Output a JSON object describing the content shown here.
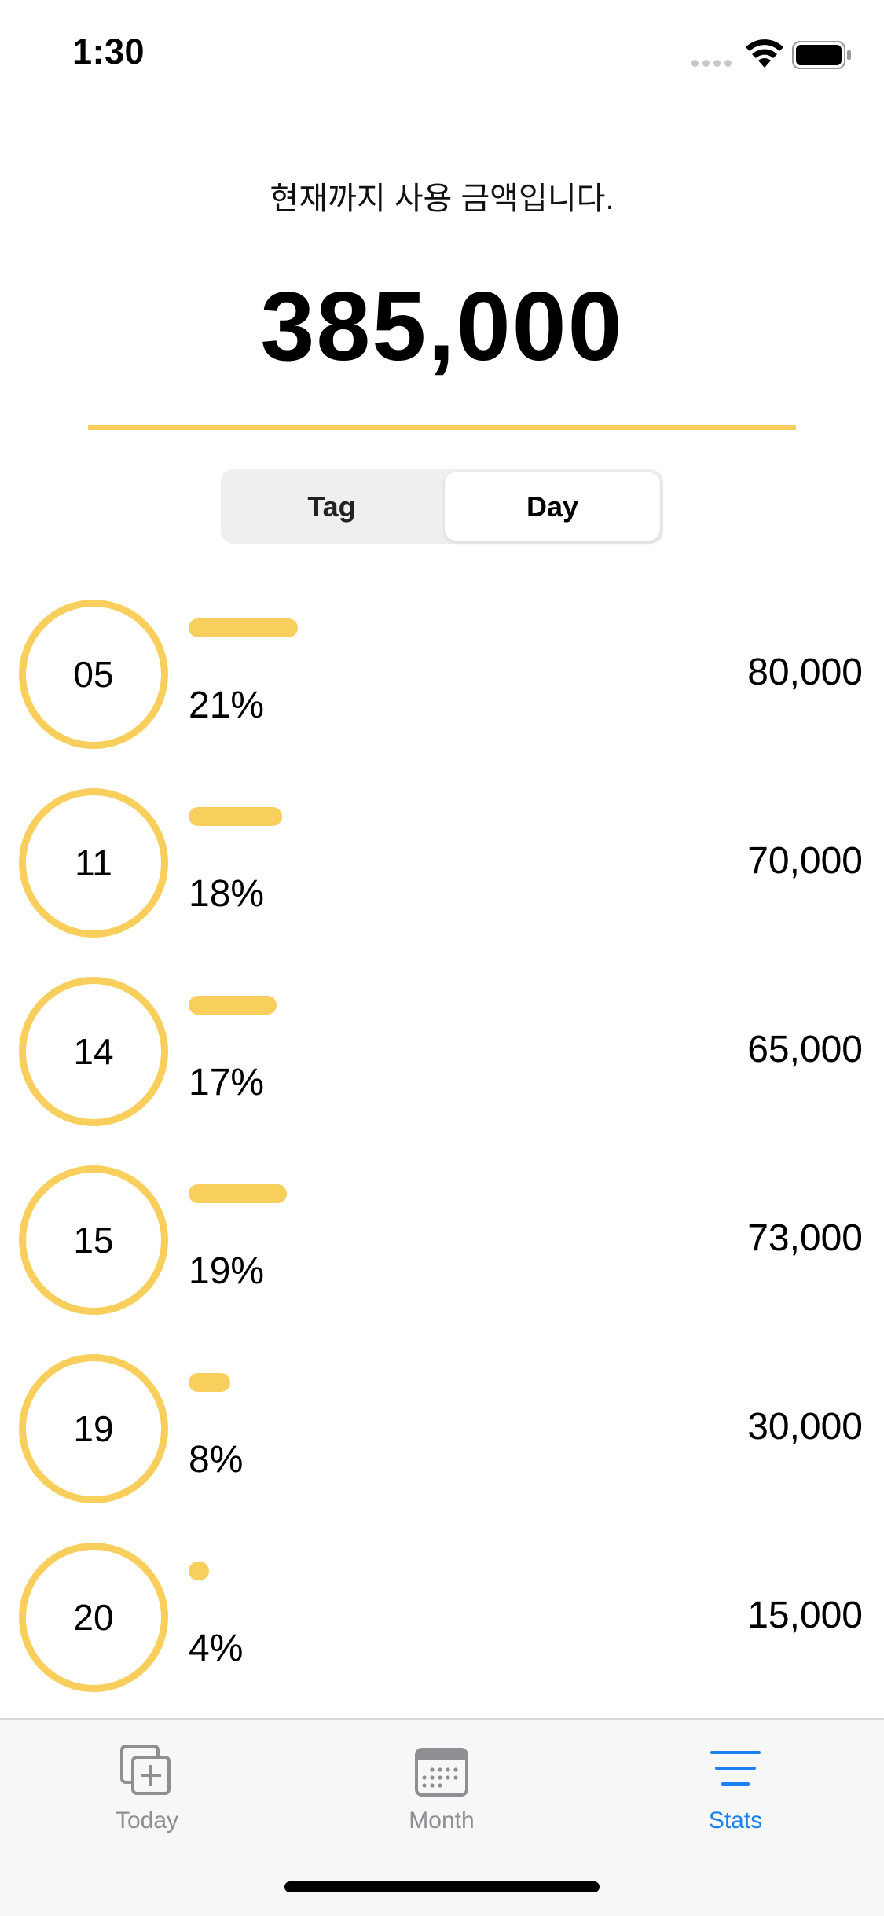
{
  "status_bar": {
    "time": "1:30"
  },
  "header": {
    "subtitle": "현재까지 사용 금액입니다.",
    "total": "385,000"
  },
  "segmented": {
    "options": [
      "Tag",
      "Day"
    ],
    "selected": "Day"
  },
  "rows": [
    {
      "day": "05",
      "percent": "21%",
      "amount": "80,000",
      "share": 0.21
    },
    {
      "day": "11",
      "percent": "18%",
      "amount": "70,000",
      "share": 0.18
    },
    {
      "day": "14",
      "percent": "17%",
      "amount": "65,000",
      "share": 0.17
    },
    {
      "day": "15",
      "percent": "19%",
      "amount": "73,000",
      "share": 0.19
    },
    {
      "day": "19",
      "percent": "8%",
      "amount": "30,000",
      "share": 0.08
    },
    {
      "day": "20",
      "percent": "4%",
      "amount": "15,000",
      "share": 0.04
    }
  ],
  "tab_bar": {
    "tabs": [
      {
        "label": "Today",
        "icon": "add-square-icon"
      },
      {
        "label": "Month",
        "icon": "calendar-icon"
      },
      {
        "label": "Stats",
        "icon": "lines-icon"
      }
    ],
    "selected": "Stats"
  },
  "colors": {
    "accent": "#f8cf5d",
    "tab_active": "#1a82f0",
    "tab_inactive": "#8e8e93"
  }
}
